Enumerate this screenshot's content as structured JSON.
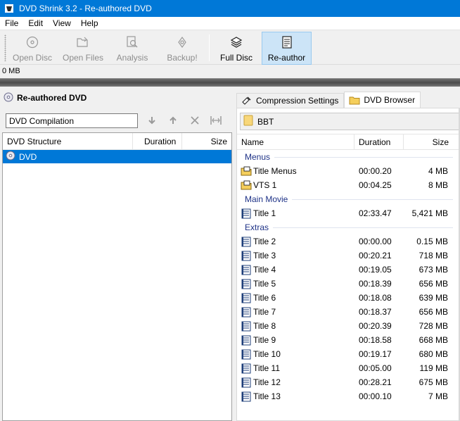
{
  "window": {
    "title": "DVD Shrink 3.2 - Re-authored DVD"
  },
  "menu": [
    "File",
    "Edit",
    "View",
    "Help"
  ],
  "toolbar": {
    "buttons": [
      {
        "label": "Open Disc",
        "icon": "disc-icon",
        "enabled": false
      },
      {
        "label": "Open Files",
        "icon": "open-folder-icon",
        "enabled": false
      },
      {
        "label": "Analysis",
        "icon": "analysis-icon",
        "enabled": false
      },
      {
        "label": "Backup!",
        "icon": "backup-icon",
        "enabled": false
      },
      {
        "label": "Full Disc",
        "icon": "full-disc-icon",
        "enabled": true
      },
      {
        "label": "Re-author",
        "icon": "re-author-icon",
        "enabled": true,
        "active": true
      }
    ]
  },
  "size_readout": "0 MB",
  "left": {
    "title": "Re-authored DVD",
    "compilation_name": "DVD Compilation",
    "columns": [
      "DVD Structure",
      "Duration",
      "Size"
    ],
    "rows": [
      {
        "name": "DVD",
        "duration": "",
        "size": ""
      }
    ]
  },
  "right": {
    "tabs": [
      "Compression Settings",
      "DVD Browser"
    ],
    "active_tab": "DVD Browser",
    "path": "BBT",
    "columns": [
      "Name",
      "Duration",
      "Size"
    ],
    "groups": [
      {
        "label": "Menus",
        "items": [
          {
            "name": "Title Menus",
            "duration": "00:00.20",
            "size": "4 MB",
            "icon": "menu-folder-icon"
          },
          {
            "name": "VTS 1",
            "duration": "00:04.25",
            "size": "8 MB",
            "icon": "menu-folder-icon"
          }
        ]
      },
      {
        "label": "Main Movie",
        "items": [
          {
            "name": "Title 1",
            "duration": "02:33.47",
            "size": "5,421 MB",
            "icon": "title-icon"
          }
        ]
      },
      {
        "label": "Extras",
        "items": [
          {
            "name": "Title 2",
            "duration": "00:00.00",
            "size": "0.15 MB",
            "icon": "title-icon"
          },
          {
            "name": "Title 3",
            "duration": "00:20.21",
            "size": "718 MB",
            "icon": "title-icon"
          },
          {
            "name": "Title 4",
            "duration": "00:19.05",
            "size": "673 MB",
            "icon": "title-icon"
          },
          {
            "name": "Title 5",
            "duration": "00:18.39",
            "size": "656 MB",
            "icon": "title-icon"
          },
          {
            "name": "Title 6",
            "duration": "00:18.08",
            "size": "639 MB",
            "icon": "title-icon"
          },
          {
            "name": "Title 7",
            "duration": "00:18.37",
            "size": "656 MB",
            "icon": "title-icon"
          },
          {
            "name": "Title 8",
            "duration": "00:20.39",
            "size": "728 MB",
            "icon": "title-icon"
          },
          {
            "name": "Title 9",
            "duration": "00:18.58",
            "size": "668 MB",
            "icon": "title-icon"
          },
          {
            "name": "Title 10",
            "duration": "00:19.17",
            "size": "680 MB",
            "icon": "title-icon"
          },
          {
            "name": "Title 11",
            "duration": "00:05.00",
            "size": "119 MB",
            "icon": "title-icon"
          },
          {
            "name": "Title 12",
            "duration": "00:28.21",
            "size": "675 MB",
            "icon": "title-icon"
          },
          {
            "name": "Title 13",
            "duration": "00:00.10",
            "size": "7 MB",
            "icon": "title-icon"
          }
        ]
      }
    ]
  }
}
